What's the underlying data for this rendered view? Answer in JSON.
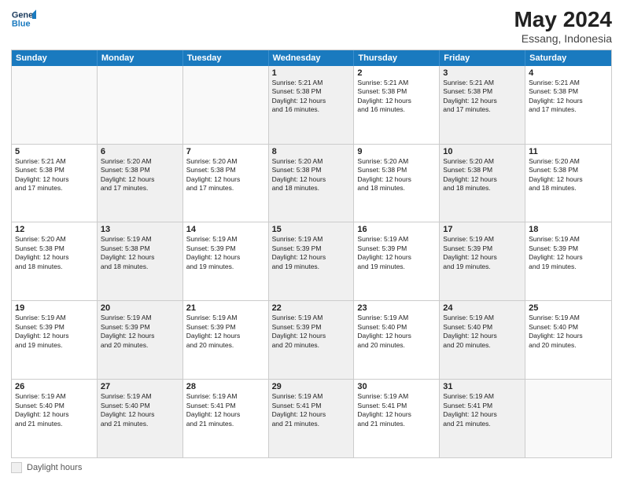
{
  "logo": {
    "line1": "General",
    "line2": "Blue"
  },
  "title": "May 2024",
  "subtitle": "Essang, Indonesia",
  "header_days": [
    "Sunday",
    "Monday",
    "Tuesday",
    "Wednesday",
    "Thursday",
    "Friday",
    "Saturday"
  ],
  "footer_label": "Daylight hours",
  "rows": [
    [
      {
        "day": "",
        "info": "",
        "empty": true
      },
      {
        "day": "",
        "info": "",
        "empty": true
      },
      {
        "day": "",
        "info": "",
        "empty": true
      },
      {
        "day": "1",
        "info": "Sunrise: 5:21 AM\nSunset: 5:38 PM\nDaylight: 12 hours\nand 16 minutes.",
        "shaded": true
      },
      {
        "day": "2",
        "info": "Sunrise: 5:21 AM\nSunset: 5:38 PM\nDaylight: 12 hours\nand 16 minutes.",
        "shaded": false
      },
      {
        "day": "3",
        "info": "Sunrise: 5:21 AM\nSunset: 5:38 PM\nDaylight: 12 hours\nand 17 minutes.",
        "shaded": true
      },
      {
        "day": "4",
        "info": "Sunrise: 5:21 AM\nSunset: 5:38 PM\nDaylight: 12 hours\nand 17 minutes.",
        "shaded": false
      }
    ],
    [
      {
        "day": "5",
        "info": "Sunrise: 5:21 AM\nSunset: 5:38 PM\nDaylight: 12 hours\nand 17 minutes.",
        "shaded": false
      },
      {
        "day": "6",
        "info": "Sunrise: 5:20 AM\nSunset: 5:38 PM\nDaylight: 12 hours\nand 17 minutes.",
        "shaded": true
      },
      {
        "day": "7",
        "info": "Sunrise: 5:20 AM\nSunset: 5:38 PM\nDaylight: 12 hours\nand 17 minutes.",
        "shaded": false
      },
      {
        "day": "8",
        "info": "Sunrise: 5:20 AM\nSunset: 5:38 PM\nDaylight: 12 hours\nand 18 minutes.",
        "shaded": true
      },
      {
        "day": "9",
        "info": "Sunrise: 5:20 AM\nSunset: 5:38 PM\nDaylight: 12 hours\nand 18 minutes.",
        "shaded": false
      },
      {
        "day": "10",
        "info": "Sunrise: 5:20 AM\nSunset: 5:38 PM\nDaylight: 12 hours\nand 18 minutes.",
        "shaded": true
      },
      {
        "day": "11",
        "info": "Sunrise: 5:20 AM\nSunset: 5:38 PM\nDaylight: 12 hours\nand 18 minutes.",
        "shaded": false
      }
    ],
    [
      {
        "day": "12",
        "info": "Sunrise: 5:20 AM\nSunset: 5:38 PM\nDaylight: 12 hours\nand 18 minutes.",
        "shaded": false
      },
      {
        "day": "13",
        "info": "Sunrise: 5:19 AM\nSunset: 5:38 PM\nDaylight: 12 hours\nand 18 minutes.",
        "shaded": true
      },
      {
        "day": "14",
        "info": "Sunrise: 5:19 AM\nSunset: 5:39 PM\nDaylight: 12 hours\nand 19 minutes.",
        "shaded": false
      },
      {
        "day": "15",
        "info": "Sunrise: 5:19 AM\nSunset: 5:39 PM\nDaylight: 12 hours\nand 19 minutes.",
        "shaded": true
      },
      {
        "day": "16",
        "info": "Sunrise: 5:19 AM\nSunset: 5:39 PM\nDaylight: 12 hours\nand 19 minutes.",
        "shaded": false
      },
      {
        "day": "17",
        "info": "Sunrise: 5:19 AM\nSunset: 5:39 PM\nDaylight: 12 hours\nand 19 minutes.",
        "shaded": true
      },
      {
        "day": "18",
        "info": "Sunrise: 5:19 AM\nSunset: 5:39 PM\nDaylight: 12 hours\nand 19 minutes.",
        "shaded": false
      }
    ],
    [
      {
        "day": "19",
        "info": "Sunrise: 5:19 AM\nSunset: 5:39 PM\nDaylight: 12 hours\nand 19 minutes.",
        "shaded": false
      },
      {
        "day": "20",
        "info": "Sunrise: 5:19 AM\nSunset: 5:39 PM\nDaylight: 12 hours\nand 20 minutes.",
        "shaded": true
      },
      {
        "day": "21",
        "info": "Sunrise: 5:19 AM\nSunset: 5:39 PM\nDaylight: 12 hours\nand 20 minutes.",
        "shaded": false
      },
      {
        "day": "22",
        "info": "Sunrise: 5:19 AM\nSunset: 5:39 PM\nDaylight: 12 hours\nand 20 minutes.",
        "shaded": true
      },
      {
        "day": "23",
        "info": "Sunrise: 5:19 AM\nSunset: 5:40 PM\nDaylight: 12 hours\nand 20 minutes.",
        "shaded": false
      },
      {
        "day": "24",
        "info": "Sunrise: 5:19 AM\nSunset: 5:40 PM\nDaylight: 12 hours\nand 20 minutes.",
        "shaded": true
      },
      {
        "day": "25",
        "info": "Sunrise: 5:19 AM\nSunset: 5:40 PM\nDaylight: 12 hours\nand 20 minutes.",
        "shaded": false
      }
    ],
    [
      {
        "day": "26",
        "info": "Sunrise: 5:19 AM\nSunset: 5:40 PM\nDaylight: 12 hours\nand 21 minutes.",
        "shaded": false
      },
      {
        "day": "27",
        "info": "Sunrise: 5:19 AM\nSunset: 5:40 PM\nDaylight: 12 hours\nand 21 minutes.",
        "shaded": true
      },
      {
        "day": "28",
        "info": "Sunrise: 5:19 AM\nSunset: 5:41 PM\nDaylight: 12 hours\nand 21 minutes.",
        "shaded": false
      },
      {
        "day": "29",
        "info": "Sunrise: 5:19 AM\nSunset: 5:41 PM\nDaylight: 12 hours\nand 21 minutes.",
        "shaded": true
      },
      {
        "day": "30",
        "info": "Sunrise: 5:19 AM\nSunset: 5:41 PM\nDaylight: 12 hours\nand 21 minutes.",
        "shaded": false
      },
      {
        "day": "31",
        "info": "Sunrise: 5:19 AM\nSunset: 5:41 PM\nDaylight: 12 hours\nand 21 minutes.",
        "shaded": true
      },
      {
        "day": "",
        "info": "",
        "empty": true
      }
    ]
  ]
}
